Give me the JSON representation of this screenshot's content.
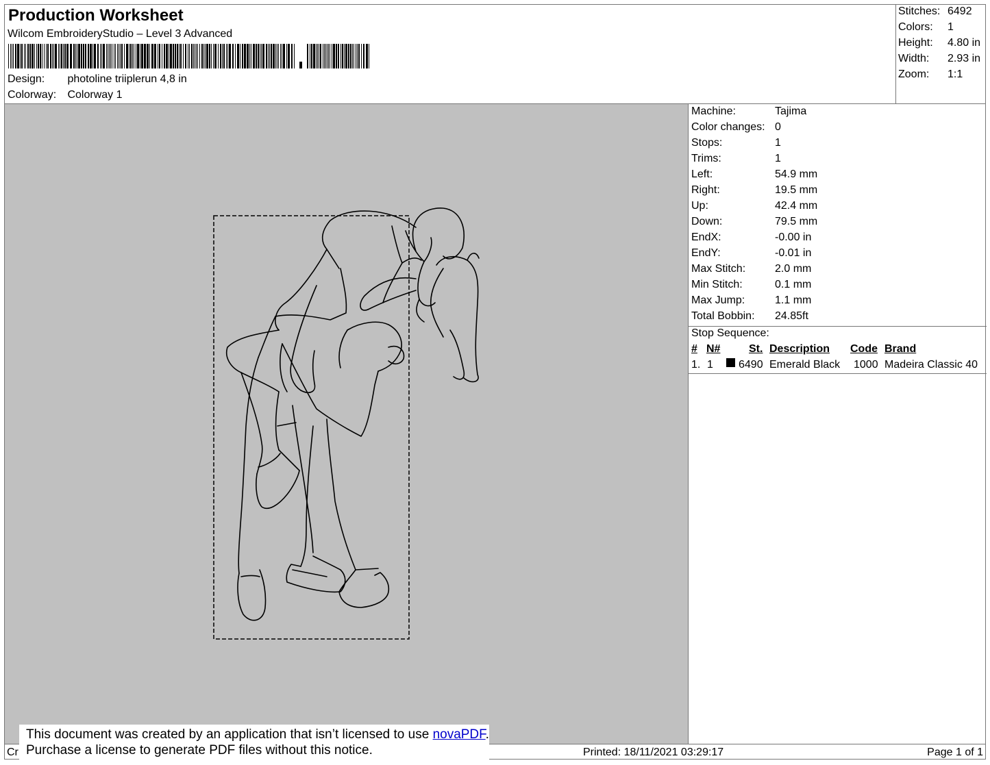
{
  "header": {
    "title": "Production Worksheet",
    "software": "Wilcom EmbroideryStudio – Level 3 Advanced",
    "design_label": "Design:",
    "design_value": "photoline triiplerun 4,8 in",
    "colorway_label": "Colorway:",
    "colorway_value": "Colorway 1"
  },
  "summary": {
    "stitches_label": "Stitches:",
    "stitches_value": "6492",
    "colors_label": "Colors:",
    "colors_value": "1",
    "height_label": "Height:",
    "height_value": "4.80 in",
    "width_label": "Width:",
    "width_value": "2.93 in",
    "zoom_label": "Zoom:",
    "zoom_value": "1:1"
  },
  "machine_info": {
    "machine_label": "Machine:",
    "machine_value": "Tajima",
    "color_changes_label": "Color changes:",
    "color_changes_value": "0",
    "stops_label": "Stops:",
    "stops_value": "1",
    "trims_label": "Trims:",
    "trims_value": "1",
    "left_label": "Left:",
    "left_value": "54.9 mm",
    "right_label": "Right:",
    "right_value": "19.5 mm",
    "up_label": "Up:",
    "up_value": "42.4 mm",
    "down_label": "Down:",
    "down_value": "79.5 mm",
    "endx_label": "EndX:",
    "endx_value": "-0.00 in",
    "endy_label": "EndY:",
    "endy_value": "-0.01 in",
    "max_stitch_label": "Max Stitch:",
    "max_stitch_value": "2.0 mm",
    "min_stitch_label": "Min Stitch:",
    "min_stitch_value": "0.1 mm",
    "max_jump_label": "Max Jump:",
    "max_jump_value": "1.1 mm",
    "total_bobbin_label": "Total Bobbin:",
    "total_bobbin_value": "24.85ft"
  },
  "stop_sequence": {
    "title": "Stop Sequence:",
    "columns": [
      "#",
      "N#",
      "St.",
      "Description",
      "Code",
      "Brand"
    ],
    "rows": [
      {
        "index": "1.",
        "n": "1",
        "stitches": "6490",
        "description": "Emerald Black",
        "code": "1000",
        "brand": "Madeira Classic 40",
        "color": "#000000"
      }
    ]
  },
  "footer": {
    "cr": "Cr",
    "printed": "Printed: 18/11/2021 03:29:17",
    "page": "Page 1 of 1"
  },
  "notice": {
    "line1_prefix": "This document was created by an application that isn’t licensed to use ",
    "link": "novaPDF",
    "line1_suffix": ".",
    "line2": "Purchase a license to generate PDF files without this notice."
  },
  "colors": {
    "preview_background": "#c0c0c0",
    "stitch_line": "#000000"
  }
}
